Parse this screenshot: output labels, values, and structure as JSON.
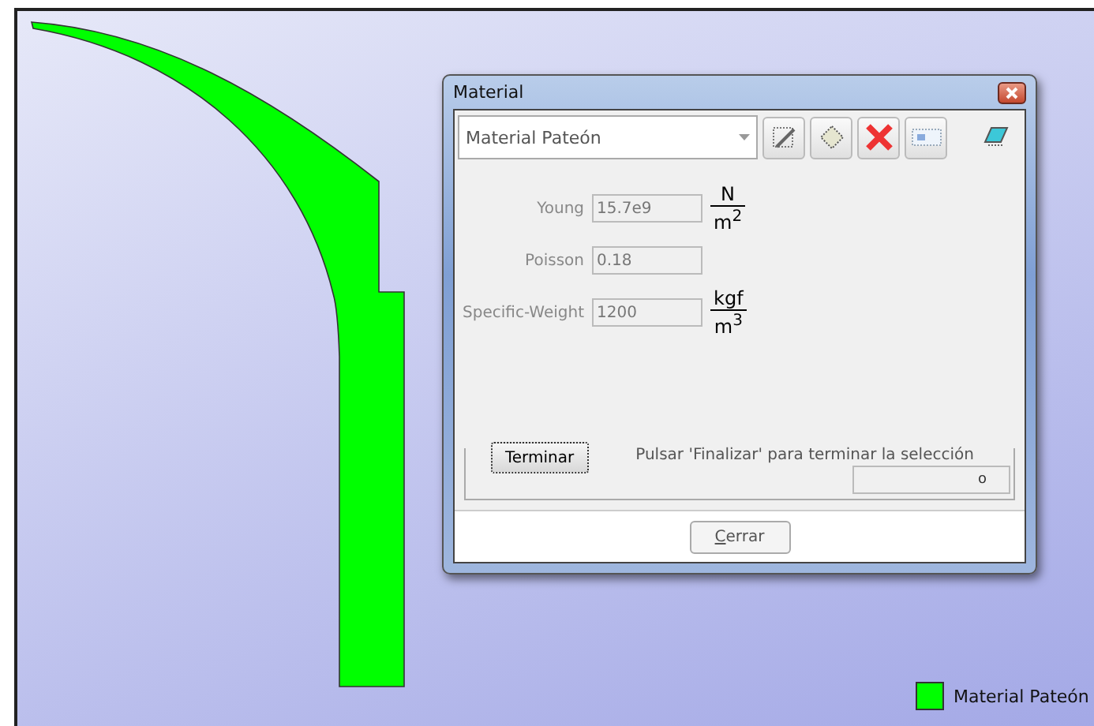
{
  "dialog": {
    "title": "Material",
    "material": "Material Pateón",
    "toolbar": [
      {
        "kind": "edit"
      },
      {
        "kind": "new"
      },
      {
        "kind": "delete"
      },
      {
        "kind": "rename"
      }
    ],
    "fields": [
      {
        "label": "Young",
        "value": "15.7e9",
        "disabled": true,
        "unit": {
          "top": "N",
          "bottom": "m$^{2}$"
        }
      },
      {
        "label": "Poisson",
        "value": "0.18",
        "disabled": true
      },
      {
        "label": "Specific-Weight",
        "value": "1200",
        "disabled": true,
        "unit": {
          "top": "kgf",
          "bottom": "m$^{3}$"
        }
      }
    ],
    "selection": {
      "button": "Terminar",
      "message": "Pulsar 'Finalizar' para terminar la selección",
      "field_value": "o"
    },
    "close_button": "Cerrar"
  },
  "legend": [
    {
      "label": "Material Pateón",
      "color": "#00ff00"
    }
  ]
}
